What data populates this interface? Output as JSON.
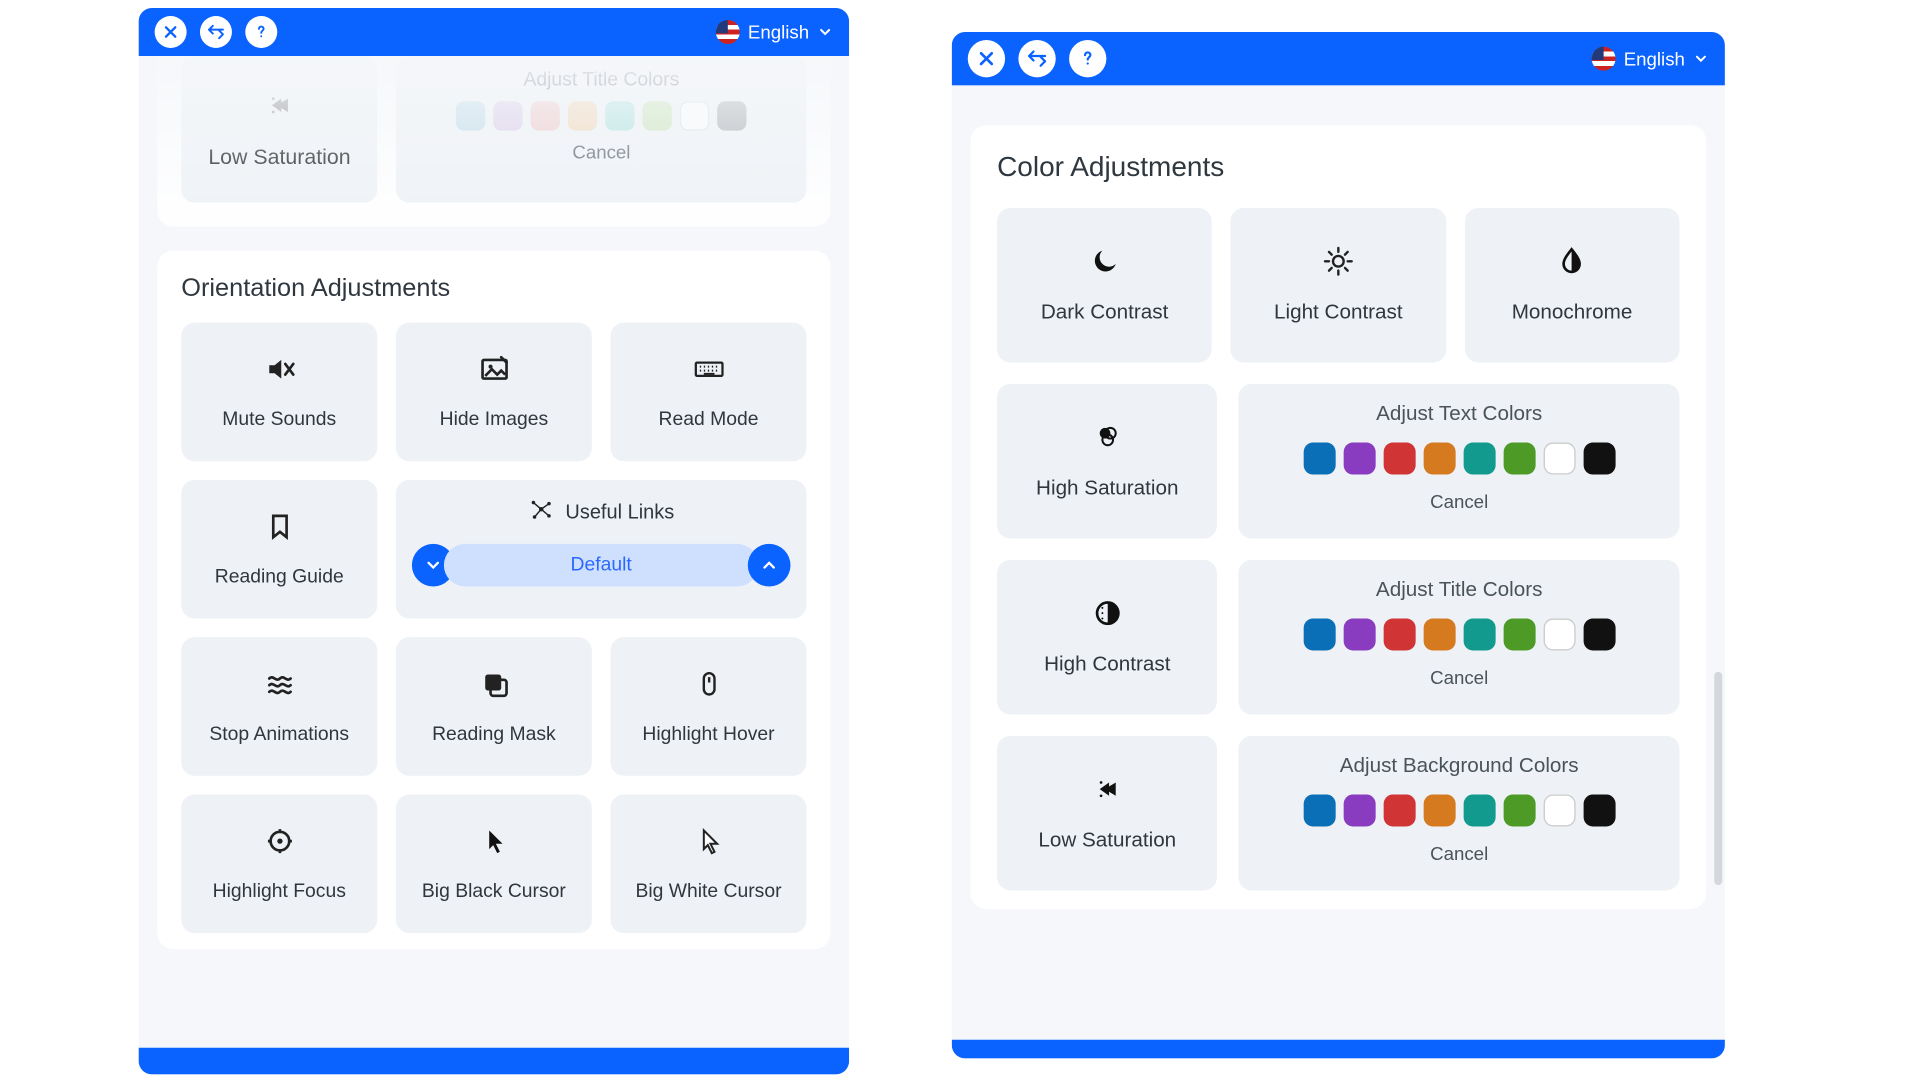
{
  "language_label": "English",
  "left": {
    "faded": {
      "low_saturation": "Low Saturation",
      "adjust_title_colors": "Adjust Title Colors",
      "cancel": "Cancel",
      "swatches": [
        "#b8d8e6",
        "#d7c6e6",
        "#eec3c3",
        "#f0d2ad",
        "#a5e0dc",
        "#c4e2b0",
        "#ffffff",
        "#a0a4a8"
      ]
    },
    "section_title": "Orientation Adjustments",
    "tiles": {
      "mute_sounds": "Mute Sounds",
      "hide_images": "Hide Images",
      "read_mode": "Read Mode",
      "reading_guide": "Reading Guide",
      "useful_links": "Useful Links",
      "useful_links_value": "Default",
      "stop_animations": "Stop Animations",
      "reading_mask": "Reading Mask",
      "highlight_hover": "Highlight Hover",
      "highlight_focus": "Highlight Focus",
      "big_black_cursor": "Big Black Cursor",
      "big_white_cursor": "Big White Cursor"
    }
  },
  "right": {
    "section_title": "Color Adjustments",
    "tiles": {
      "dark_contrast": "Dark Contrast",
      "light_contrast": "Light Contrast",
      "monochrome": "Monochrome",
      "high_saturation": "High Saturation",
      "high_contrast": "High Contrast",
      "low_saturation": "Low Saturation"
    },
    "color_rows": {
      "text": {
        "title": "Adjust Text Colors",
        "cancel": "Cancel"
      },
      "title": {
        "title": "Adjust Title Colors",
        "cancel": "Cancel"
      },
      "background": {
        "title": "Adjust Background Colors",
        "cancel": "Cancel"
      }
    },
    "swatches": [
      "#0b6fb8",
      "#8a3cc0",
      "#d03434",
      "#d57a1e",
      "#139a8e",
      "#4e9a26",
      "#ffffff",
      "#111111"
    ]
  }
}
